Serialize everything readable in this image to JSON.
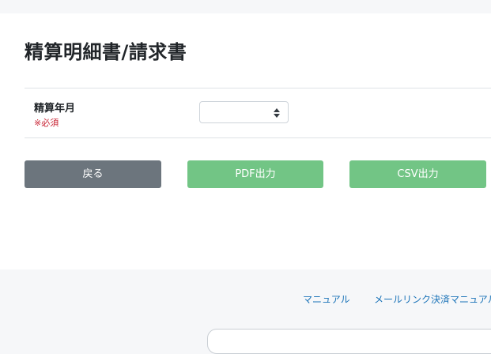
{
  "page": {
    "title": "精算明細書/請求書"
  },
  "form": {
    "field_label": "精算年月",
    "required_note": "※必須",
    "select_value": ""
  },
  "buttons": {
    "back": "戻る",
    "pdf": "PDF出力",
    "csv": "CSV出力"
  },
  "footer": {
    "links": [
      "マニュアル",
      "メールリンク決済マニュアル"
    ]
  },
  "colors": {
    "back_button": "#6c757d",
    "export_button": "#72c585",
    "required_text": "#c82333",
    "link_text": "#1a73b8"
  }
}
